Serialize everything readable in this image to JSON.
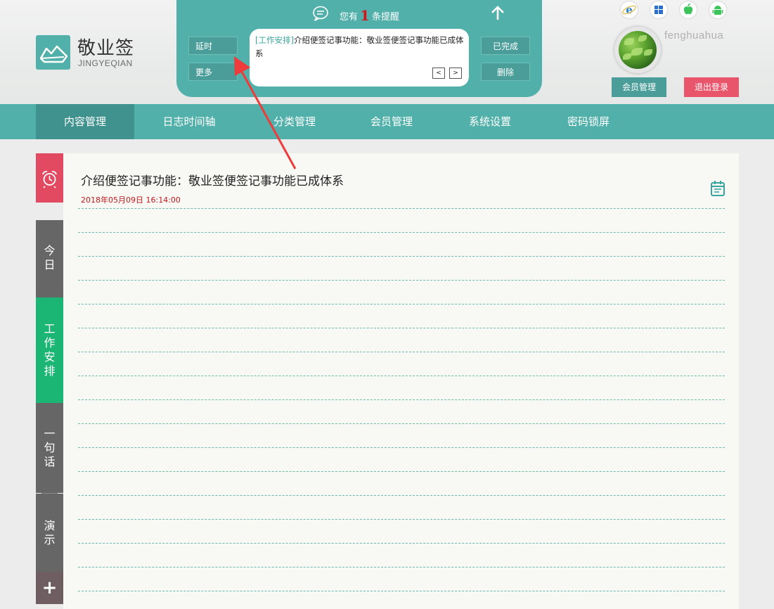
{
  "brand": {
    "title": "敬业签",
    "subtitle": "JINGYEQIAN"
  },
  "reminder": {
    "prefix": "您有",
    "count": "1",
    "suffix": "条提醒",
    "delay_label": "延时",
    "more_label": "更多",
    "done_label": "已完成",
    "delete_label": "删除",
    "note_category": "[工作安排]",
    "note_text": "介绍便签记事功能：敬业签便签记事功能已成体系",
    "prev_label": "<",
    "next_label": ">"
  },
  "platforms": [
    "ie-icon",
    "windows-icon",
    "apple-icon",
    "android-icon"
  ],
  "user": {
    "name": "fenghuahua",
    "member_btn": "会员管理",
    "logout_btn": "退出登录"
  },
  "nav": {
    "items": [
      {
        "label": "内容管理",
        "active": true
      },
      {
        "label": "日志时间轴"
      },
      {
        "label": "分类管理"
      },
      {
        "label": "会员管理"
      },
      {
        "label": "系统设置"
      },
      {
        "label": "密码锁屏"
      }
    ]
  },
  "sidebar": {
    "items": [
      {
        "chars": [
          "今",
          "日"
        ]
      },
      {
        "chars": [
          "工",
          "作",
          "安",
          "排"
        ]
      },
      {
        "chars": [
          "一",
          "句",
          "话"
        ]
      },
      {
        "chars": [
          "演",
          "示"
        ]
      }
    ],
    "add_label": "+"
  },
  "note": {
    "title": "介绍便签记事功能：敬业签便签记事功能已成体系",
    "datetime": "2018年05月09日 16:14:00"
  },
  "colors": {
    "teal": "#52b0aa",
    "teal_dark": "#3f928d",
    "red": "#e24a61",
    "green": "#1bb574",
    "gray": "#666666",
    "date_red": "#c0161a"
  }
}
